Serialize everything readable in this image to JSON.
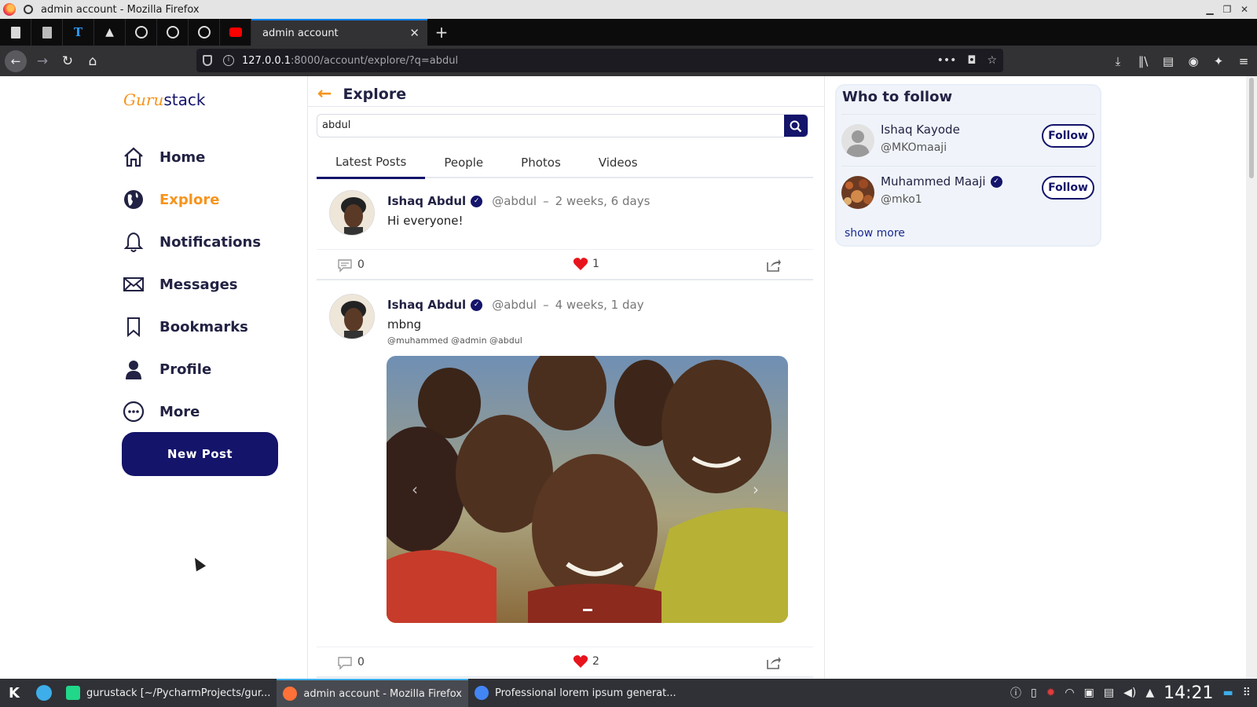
{
  "window": {
    "title": "admin account - Mozilla Firefox"
  },
  "browser": {
    "active_tab_title": "admin account",
    "url_host": "127.0.0.1",
    "url_path": ":8000/account/explore/?q=abdul"
  },
  "app": {
    "logo_part1": "Guru",
    "logo_part2": "stack",
    "brand_color": "#14146b",
    "accent_color": "#f7941d"
  },
  "sidebar": {
    "items": [
      {
        "label": "Home",
        "icon": "home-icon"
      },
      {
        "label": "Explore",
        "icon": "globe-icon",
        "active": true
      },
      {
        "label": "Notifications",
        "icon": "bell-icon"
      },
      {
        "label": "Messages",
        "icon": "envelope-icon"
      },
      {
        "label": "Bookmarks",
        "icon": "bookmark-icon"
      },
      {
        "label": "Profile",
        "icon": "user-icon"
      },
      {
        "label": "More",
        "icon": "more-icon"
      }
    ],
    "new_post_label": "New Post"
  },
  "explore": {
    "title": "Explore",
    "search_value": "abdul",
    "tabs": [
      "Latest Posts",
      "People",
      "Photos",
      "Videos"
    ]
  },
  "posts": [
    {
      "name": "Ishaq Abdul",
      "handle": "@abdul",
      "sep": "–",
      "time": "2 weeks, 6 days",
      "text": "Hi everyone!",
      "comments": "0",
      "likes": "1"
    },
    {
      "name": "Ishaq Abdul",
      "handle": "@abdul",
      "sep": "–",
      "time": "4 weeks, 1 day",
      "text": "mbng",
      "mentions": "@muhammed @admin @abdul",
      "comments": "0",
      "likes": "2"
    }
  ],
  "who_to_follow": {
    "title": "Who to follow",
    "users": [
      {
        "name": "Ishaq Kayode",
        "handle": "@MKOmaaji",
        "verified": false,
        "button": "Follow"
      },
      {
        "name": "Muhammed Maaji",
        "handle": "@mko1",
        "verified": true,
        "button": "Follow"
      }
    ],
    "show_more": "show more"
  },
  "taskbar": {
    "tasks": [
      "gurustack [~/PycharmProjects/gur...",
      "admin account - Mozilla Firefox",
      "Professional lorem ipsum generat..."
    ],
    "clock": "14:21"
  }
}
